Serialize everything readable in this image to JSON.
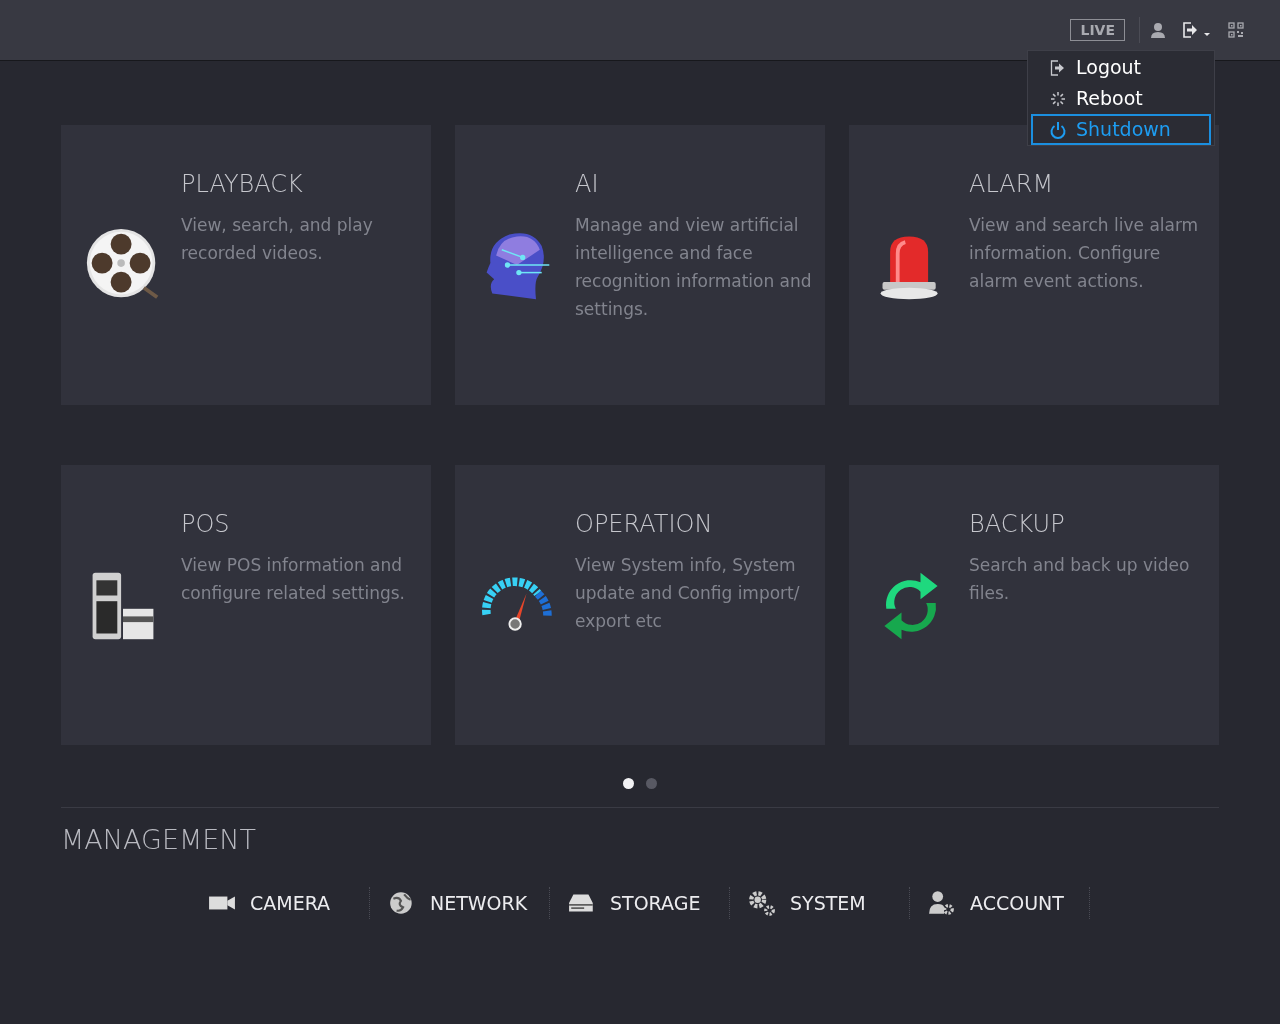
{
  "topbar": {
    "live_label": "LIVE"
  },
  "menu": {
    "items": [
      {
        "label": "Logout",
        "selected": false
      },
      {
        "label": "Reboot",
        "selected": false
      },
      {
        "label": "Shutdown",
        "selected": true
      }
    ]
  },
  "cards": [
    {
      "title": "PLAYBACK",
      "description": "View, search, and play recorded videos."
    },
    {
      "title": "AI",
      "description": "Manage and view artificial intelligence and face recognition information and settings."
    },
    {
      "title": "ALARM",
      "description": "View and search live alarm information. Configure alarm event actions."
    },
    {
      "title": "POS",
      "description": "View POS information and configure related settings."
    },
    {
      "title": "OPERATION",
      "description": "View System info, System update and Config import/ export etc"
    },
    {
      "title": "BACKUP",
      "description": "Search and back up video files."
    }
  ],
  "pager": [
    {
      "selected": true
    },
    {
      "selected": false
    }
  ],
  "management": {
    "title": "MANAGEMENT",
    "items": [
      {
        "label": "CAMERA"
      },
      {
        "label": "NETWORK"
      },
      {
        "label": "STORAGE"
      },
      {
        "label": "SYSTEM"
      },
      {
        "label": "ACCOUNT"
      }
    ]
  }
}
